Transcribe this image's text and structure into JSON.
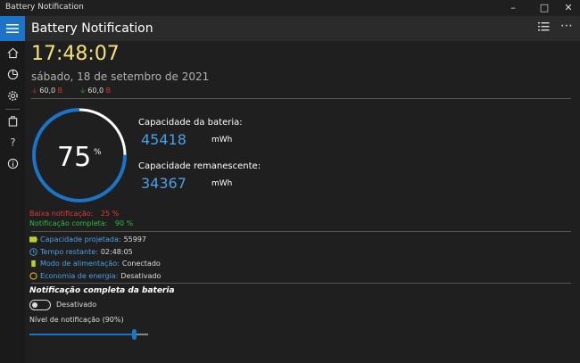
{
  "window": {
    "title": "Battery Notification"
  },
  "header": {
    "title": "Battery Notification"
  },
  "clock": "17:48:07",
  "date": "sábado, 18 de setembro de 2021",
  "rates": {
    "discharge_value": "60,0",
    "discharge_unit": "B",
    "charge_value": "60,0",
    "charge_unit": "B"
  },
  "gauge": {
    "percent": "75",
    "percent_sign": "%",
    "fraction": 0.75,
    "color": "#1b74c8"
  },
  "capacity": {
    "battery_label": "Capacidade da bateria:",
    "battery_value": "45418",
    "battery_unit": "mWh",
    "remaining_label": "Capacidade remanescente:",
    "remaining_value": "34367",
    "remaining_unit": "mWh"
  },
  "notifications": {
    "low_label": "Baixa notificação:",
    "low_value": "25 %",
    "low_color": "#e03a3a",
    "full_label": "Notificação completa:",
    "full_value": "90 %",
    "full_color": "#2fb84a"
  },
  "info": [
    {
      "icon": "battery-icon",
      "label": "Capacidade projetada:",
      "value": "55997"
    },
    {
      "icon": "clock-icon",
      "label": "Tempo restante:",
      "value": "02:48:05"
    },
    {
      "icon": "plug-icon",
      "label": "Modo de alimentação:",
      "value": "Conectado"
    },
    {
      "icon": "leaf-icon",
      "label": "Economia de energia:",
      "value": "Desativado"
    }
  ],
  "full_battery": {
    "title": "Notificação completa da bateria",
    "toggle_label": "Desativado",
    "level_label": "Nível de notificação (90%)",
    "level": 0.9
  },
  "colors": {
    "accent": "#1b74c8",
    "clock": "#f5e27a",
    "value_blue": "#4aa0e6"
  }
}
